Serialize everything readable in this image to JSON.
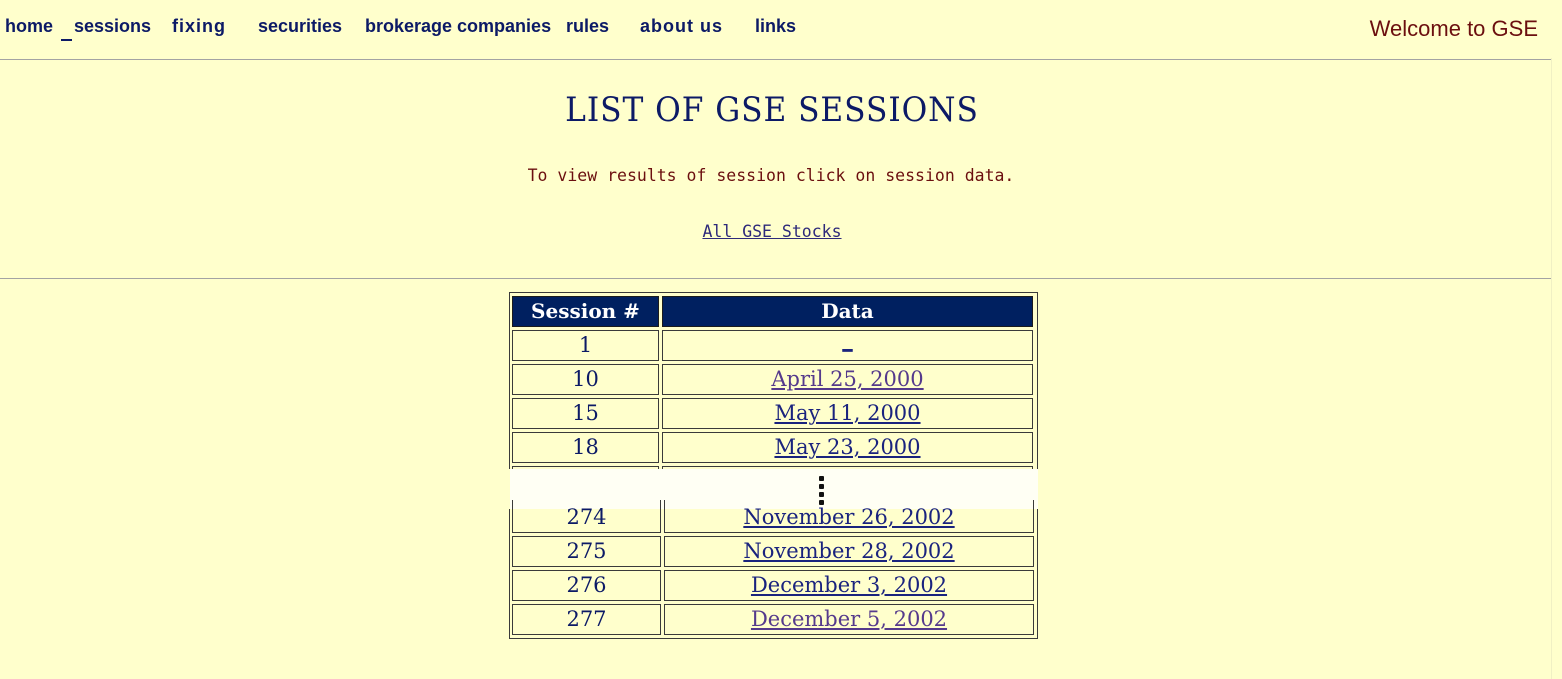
{
  "nav": {
    "items": [
      {
        "label": "home"
      },
      {
        "label": "sessions"
      },
      {
        "label": "fixing"
      },
      {
        "label": "securities"
      },
      {
        "label": "brokerage companies"
      },
      {
        "label": "rules"
      },
      {
        "label": "about us"
      },
      {
        "label": "links"
      }
    ],
    "welcome": "Welcome to GSE"
  },
  "main": {
    "title": "LIST OF GSE SESSIONS",
    "instruction": "To view results of session click on session data.",
    "all_stocks_link": "All GSE Stocks"
  },
  "table": {
    "headers": [
      "Session #",
      "Data"
    ],
    "rows_top": [
      {
        "session": "1",
        "data": "_"
      },
      {
        "session": "10",
        "data": "April 25, 2000"
      },
      {
        "session": "15",
        "data": "May 11, 2000"
      },
      {
        "session": "18",
        "data": "May 23, 2000"
      }
    ],
    "rows_bottom": [
      {
        "session": "274",
        "data": "November 26, 2002"
      },
      {
        "session": "275",
        "data": "November 28, 2002"
      },
      {
        "session": "276",
        "data": "December 3, 2002"
      },
      {
        "session": "277",
        "data": "December 5, 2002"
      }
    ]
  },
  "colors": {
    "background": "#ffffcc",
    "header_bg": "#002060",
    "nav_text": "#0c1a66",
    "welcome_text": "#6b0f0f"
  }
}
